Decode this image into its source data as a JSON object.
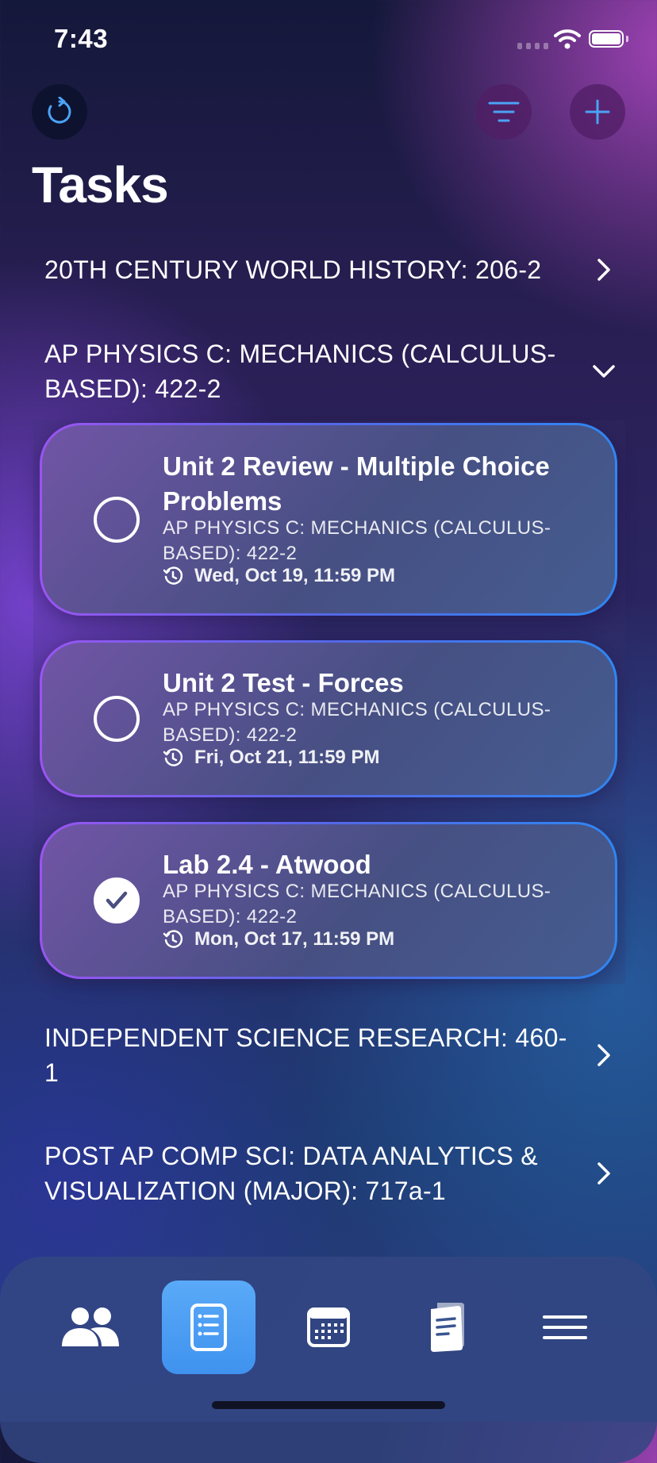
{
  "status_bar": {
    "time": "7:43"
  },
  "toolbar": {
    "refresh_icon": "refresh-icon",
    "filter_icon": "filter-icon",
    "add_icon": "plus-icon",
    "accent": "#4aa3f5"
  },
  "page": {
    "title": "Tasks"
  },
  "courses": [
    {
      "label": "20TH CENTURY WORLD HISTORY: 206-2",
      "expanded": false
    },
    {
      "label": "AP PHYSICS C: MECHANICS (CALCULUS-BASED): 422-2",
      "expanded": true
    },
    {
      "label": "INDEPENDENT SCIENCE RESEARCH: 460-1",
      "expanded": false
    },
    {
      "label": "POST AP COMP SCI: DATA ANALYTICS & VISUALIZATION (MAJOR): 717a-1",
      "expanded": false
    }
  ],
  "tasks": [
    {
      "title": "Unit 2 Review - Multiple Choice Problems",
      "course": "AP PHYSICS C: MECHANICS (CALCULUS-BASED): 422-2",
      "due": "Wed, Oct 19, 11:59 PM",
      "completed": false
    },
    {
      "title": "Unit 2 Test - Forces",
      "course": "AP PHYSICS C: MECHANICS (CALCULUS-BASED): 422-2",
      "due": "Fri, Oct 21, 11:59 PM",
      "completed": false
    },
    {
      "title": "Lab 2.4 - Atwood",
      "course": "AP PHYSICS C: MECHANICS (CALCULUS-BASED): 422-2",
      "due": "Mon, Oct 17, 11:59 PM",
      "completed": true
    }
  ],
  "tab_bar": {
    "tabs": [
      {
        "icon": "people-icon",
        "active": false
      },
      {
        "icon": "tasks-list-icon",
        "active": true
      },
      {
        "icon": "calendar-icon",
        "active": false
      },
      {
        "icon": "notes-icon",
        "active": false
      },
      {
        "icon": "menu-icon",
        "active": false
      }
    ],
    "active_color": "#4a9ef4"
  }
}
